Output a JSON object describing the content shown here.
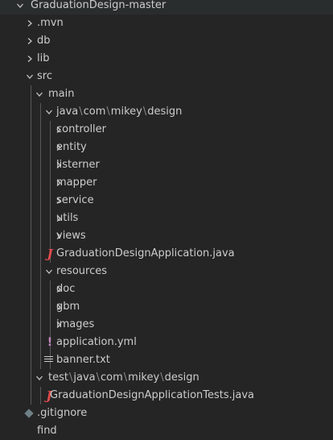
{
  "explorer": {
    "root_label": "GraduationDesign-master",
    "items": [
      {
        "label": "GraduationDesign-master",
        "kind": "folder",
        "expanded": true
      },
      {
        "label": ".mvn",
        "kind": "folder",
        "expanded": false
      },
      {
        "label": "db",
        "kind": "folder",
        "expanded": false
      },
      {
        "label": "lib",
        "kind": "folder",
        "expanded": false
      },
      {
        "label": "src",
        "kind": "folder",
        "expanded": true
      },
      {
        "label": "main",
        "kind": "folder",
        "expanded": true
      },
      {
        "label": "java\\com\\mikey\\design",
        "kind": "folder",
        "expanded": true
      },
      {
        "label": "controller",
        "kind": "folder",
        "expanded": false
      },
      {
        "label": "entity",
        "kind": "folder",
        "expanded": false
      },
      {
        "label": "listerner",
        "kind": "folder",
        "expanded": false
      },
      {
        "label": "mapper",
        "kind": "folder",
        "expanded": false
      },
      {
        "label": "service",
        "kind": "folder",
        "expanded": false
      },
      {
        "label": "utils",
        "kind": "folder",
        "expanded": false
      },
      {
        "label": "views",
        "kind": "folder",
        "expanded": false
      },
      {
        "label": "GraduationDesignApplication.java",
        "kind": "java-file"
      },
      {
        "label": "resources",
        "kind": "folder",
        "expanded": true
      },
      {
        "label": "doc",
        "kind": "folder",
        "expanded": false
      },
      {
        "label": "gbm",
        "kind": "folder",
        "expanded": false
      },
      {
        "label": "images",
        "kind": "folder",
        "expanded": false
      },
      {
        "label": "application.yml",
        "kind": "yml-file"
      },
      {
        "label": "banner.txt",
        "kind": "text-file"
      },
      {
        "label": "test\\java\\com\\mikey\\design",
        "kind": "folder",
        "expanded": true
      },
      {
        "label": "GraduationDesignApplicationTests.java",
        "kind": "java-file"
      },
      {
        "label": ".gitignore",
        "kind": "git-file"
      },
      {
        "label": "find",
        "kind": "file"
      }
    ]
  },
  "icons": {
    "chevron_right": "chevron-right-icon",
    "chevron_down": "chevron-down-icon",
    "java": "java-file-icon",
    "yml": "yml-file-icon",
    "txt": "text-file-icon",
    "git": "git-file-icon"
  },
  "colors": {
    "background": "#252526",
    "text": "#cccccc",
    "java_icon": "#e34c4c",
    "yml_icon": "#c586c0",
    "git_icon": "#6d8086",
    "indent_guide": "#585858"
  }
}
